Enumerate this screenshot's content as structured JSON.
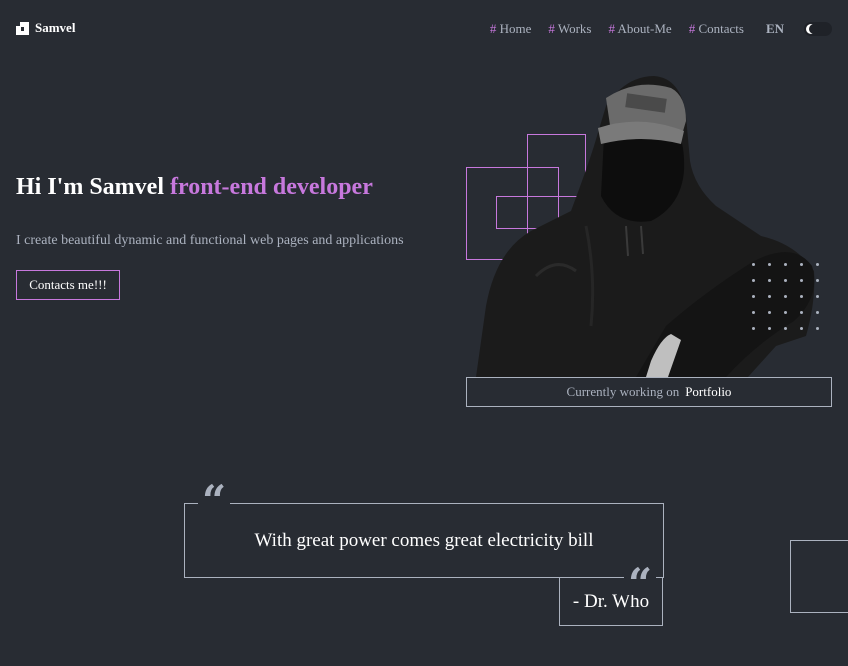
{
  "header": {
    "logo_name": "Samvel",
    "nav": [
      {
        "hash": "#",
        "label": " Home"
      },
      {
        "hash": "#",
        "label": " Works"
      },
      {
        "hash": "#",
        "label": " About-Me"
      },
      {
        "hash": "#",
        "label": " Contacts"
      }
    ],
    "lang": "EN"
  },
  "hero": {
    "title_plain": "Hi I'm Samvel ",
    "title_accent": "front-end developer",
    "subtitle": "I create beautiful dynamic and functional web pages and applications",
    "cta_label": "Contacts me!!!",
    "status_prefix": "Currently working on",
    "status_project": "Portfolio"
  },
  "quote": {
    "text": "With great power comes great electricity bill",
    "author": "- Dr. Who",
    "mark": "“"
  },
  "icons": [
    "logo-icon",
    "theme-toggle-icon",
    "quote-icon"
  ],
  "colors": {
    "background": "#282c33",
    "accent": "#c778dd",
    "muted": "#abb2bf",
    "text": "#ffffff"
  }
}
